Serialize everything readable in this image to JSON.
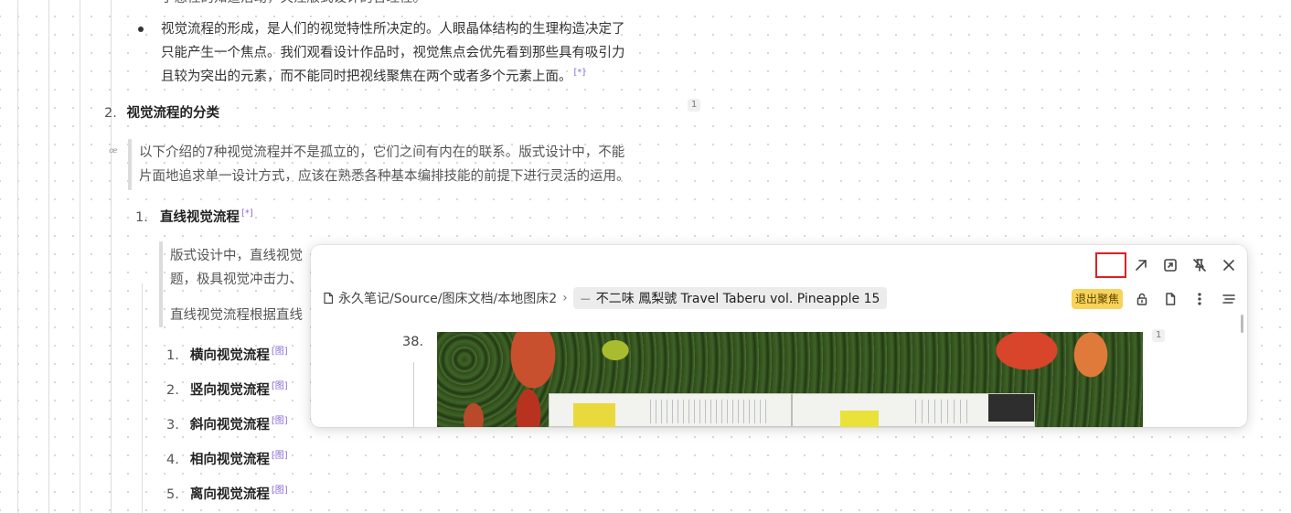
{
  "doc": {
    "top_partial": "于感性的知道活动，关注版式设计的合理性。",
    "bullet_lines": [
      "视觉流程的形成，是人们的视觉特性所决定的。人眼晶体结构的生理构造决定了",
      "只能产生一个焦点。我们观看设计作品时，视觉焦点会优先看到那些具有吸引力",
      "且较为突出的元素，而不能同时把视线聚焦在两个或者多个元素上面。"
    ],
    "ref_marker": "[*]",
    "section2": {
      "number": "2.",
      "title": "视觉流程的分类",
      "badge": "1"
    },
    "quote_icon": "ꟹ",
    "quote_lines": [
      "以下介绍的7种视觉流程并不是孤立的，它们之间有内在的联系。版式设计中，不能",
      "片面地追求单一设计方式，应该在熟悉各种基本编排技能的前提下进行灵活的运用。"
    ],
    "sub1": {
      "number": "1.",
      "title": "直线视觉流程",
      "ref": "[*]"
    },
    "sub1_quote_lines": [
      "版式设计中，直线视觉",
      "题，极具视觉冲击力、"
    ],
    "sub1_quote_line3": "直线视觉流程根据直线",
    "list": [
      {
        "number": "1.",
        "title": "横向视觉流程",
        "ref": "[图]"
      },
      {
        "number": "2.",
        "title": "竖向视觉流程",
        "ref": "[图]"
      },
      {
        "number": "3.",
        "title": "斜向视觉流程",
        "ref": "[图]"
      },
      {
        "number": "4.",
        "title": "相向视觉流程",
        "ref": "[图]"
      },
      {
        "number": "5.",
        "title": "离向视觉流程",
        "ref": "[图]"
      }
    ]
  },
  "popup": {
    "breadcrumb_path": "永久笔记/Source/图床文档/本地图床2",
    "breadcrumb_sep": "›",
    "current_prefix": "—",
    "current_title": "不二味 鳳梨號 Travel Taberu vol. Pineapple 15",
    "exit_focus": "退出聚焦",
    "line_number": "38.",
    "badge": "1",
    "icons": [
      "focus-icon",
      "open-external-icon",
      "jump-to-icon",
      "unpin-icon",
      "close-icon",
      "lock-icon",
      "file-icon",
      "more-icon",
      "outline-icon"
    ]
  }
}
